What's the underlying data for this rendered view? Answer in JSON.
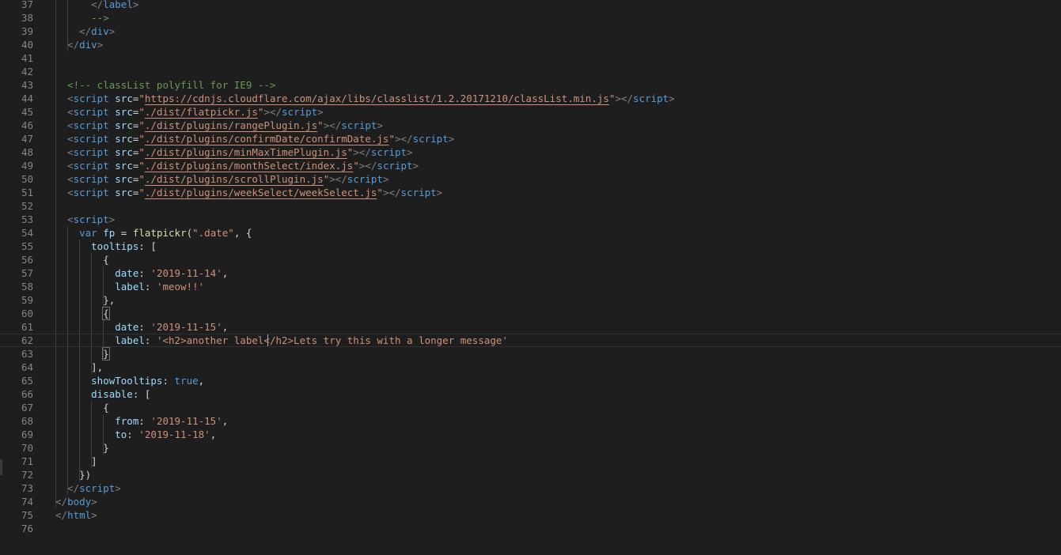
{
  "editor": {
    "current_line": 62,
    "lines": [
      {
        "n": "37",
        "tokens": [
          [
            "tk-punct",
            "      </"
          ],
          [
            "tk-tag",
            "label"
          ],
          [
            "tk-punct",
            ">"
          ]
        ]
      },
      {
        "n": "38",
        "tokens": [
          [
            "tk-comment",
            "      -->"
          ]
        ]
      },
      {
        "n": "39",
        "tokens": [
          [
            "tk-punct",
            "    </"
          ],
          [
            "tk-tag",
            "div"
          ],
          [
            "tk-punct",
            ">"
          ]
        ]
      },
      {
        "n": "40",
        "tokens": [
          [
            "tk-punct",
            "  </"
          ],
          [
            "tk-tag",
            "div"
          ],
          [
            "tk-punct",
            ">"
          ]
        ]
      },
      {
        "n": "41",
        "tokens": []
      },
      {
        "n": "42",
        "tokens": []
      },
      {
        "n": "43",
        "tokens": [
          [
            "tk-comment",
            "  <!-- classList polyfill for IE9 -->"
          ]
        ]
      },
      {
        "n": "44",
        "tokens": [
          [
            "tk-punct",
            "  <"
          ],
          [
            "tk-tag",
            "script"
          ],
          [
            "tk-plain",
            " "
          ],
          [
            "tk-attr",
            "src"
          ],
          [
            "tk-plain",
            "="
          ],
          [
            "tk-str",
            "\""
          ],
          [
            "tk-link",
            "https://cdnjs.cloudflare.com/ajax/libs/classlist/1.2.20171210/classList.min.js"
          ],
          [
            "tk-str",
            "\""
          ],
          [
            "tk-punct",
            "></"
          ],
          [
            "tk-tag",
            "script"
          ],
          [
            "tk-punct",
            ">"
          ]
        ]
      },
      {
        "n": "45",
        "tokens": [
          [
            "tk-punct",
            "  <"
          ],
          [
            "tk-tag",
            "script"
          ],
          [
            "tk-plain",
            " "
          ],
          [
            "tk-attr",
            "src"
          ],
          [
            "tk-plain",
            "="
          ],
          [
            "tk-str",
            "\""
          ],
          [
            "tk-link",
            "./dist/flatpickr.js"
          ],
          [
            "tk-str",
            "\""
          ],
          [
            "tk-punct",
            "></"
          ],
          [
            "tk-tag",
            "script"
          ],
          [
            "tk-punct",
            ">"
          ]
        ]
      },
      {
        "n": "46",
        "tokens": [
          [
            "tk-punct",
            "  <"
          ],
          [
            "tk-tag",
            "script"
          ],
          [
            "tk-plain",
            " "
          ],
          [
            "tk-attr",
            "src"
          ],
          [
            "tk-plain",
            "="
          ],
          [
            "tk-str",
            "\""
          ],
          [
            "tk-link",
            "./dist/plugins/rangePlugin.js"
          ],
          [
            "tk-str",
            "\""
          ],
          [
            "tk-punct",
            "></"
          ],
          [
            "tk-tag",
            "script"
          ],
          [
            "tk-punct",
            ">"
          ]
        ]
      },
      {
        "n": "47",
        "tokens": [
          [
            "tk-punct",
            "  <"
          ],
          [
            "tk-tag",
            "script"
          ],
          [
            "tk-plain",
            " "
          ],
          [
            "tk-attr",
            "src"
          ],
          [
            "tk-plain",
            "="
          ],
          [
            "tk-str",
            "\""
          ],
          [
            "tk-link",
            "./dist/plugins/confirmDate/confirmDate.js"
          ],
          [
            "tk-str",
            "\""
          ],
          [
            "tk-punct",
            "></"
          ],
          [
            "tk-tag",
            "script"
          ],
          [
            "tk-punct",
            ">"
          ]
        ]
      },
      {
        "n": "48",
        "tokens": [
          [
            "tk-punct",
            "  <"
          ],
          [
            "tk-tag",
            "script"
          ],
          [
            "tk-plain",
            " "
          ],
          [
            "tk-attr",
            "src"
          ],
          [
            "tk-plain",
            "="
          ],
          [
            "tk-str",
            "\""
          ],
          [
            "tk-link",
            "./dist/plugins/minMaxTimePlugin.js"
          ],
          [
            "tk-str",
            "\""
          ],
          [
            "tk-punct",
            "></"
          ],
          [
            "tk-tag",
            "script"
          ],
          [
            "tk-punct",
            ">"
          ]
        ]
      },
      {
        "n": "49",
        "tokens": [
          [
            "tk-punct",
            "  <"
          ],
          [
            "tk-tag",
            "script"
          ],
          [
            "tk-plain",
            " "
          ],
          [
            "tk-attr",
            "src"
          ],
          [
            "tk-plain",
            "="
          ],
          [
            "tk-str",
            "\""
          ],
          [
            "tk-link",
            "./dist/plugins/monthSelect/index.js"
          ],
          [
            "tk-str",
            "\""
          ],
          [
            "tk-punct",
            "></"
          ],
          [
            "tk-tag",
            "script"
          ],
          [
            "tk-punct",
            ">"
          ]
        ]
      },
      {
        "n": "50",
        "tokens": [
          [
            "tk-punct",
            "  <"
          ],
          [
            "tk-tag",
            "script"
          ],
          [
            "tk-plain",
            " "
          ],
          [
            "tk-attr",
            "src"
          ],
          [
            "tk-plain",
            "="
          ],
          [
            "tk-str",
            "\""
          ],
          [
            "tk-link",
            "./dist/plugins/scrollPlugin.js"
          ],
          [
            "tk-str",
            "\""
          ],
          [
            "tk-punct",
            "></"
          ],
          [
            "tk-tag",
            "script"
          ],
          [
            "tk-punct",
            ">"
          ]
        ]
      },
      {
        "n": "51",
        "tokens": [
          [
            "tk-punct",
            "  <"
          ],
          [
            "tk-tag",
            "script"
          ],
          [
            "tk-plain",
            " "
          ],
          [
            "tk-attr",
            "src"
          ],
          [
            "tk-plain",
            "="
          ],
          [
            "tk-str",
            "\""
          ],
          [
            "tk-link",
            "./dist/plugins/weekSelect/weekSelect.js"
          ],
          [
            "tk-str",
            "\""
          ],
          [
            "tk-punct",
            "></"
          ],
          [
            "tk-tag",
            "script"
          ],
          [
            "tk-punct",
            ">"
          ]
        ]
      },
      {
        "n": "52",
        "tokens": []
      },
      {
        "n": "53",
        "tokens": [
          [
            "tk-punct",
            "  <"
          ],
          [
            "tk-tag",
            "script"
          ],
          [
            "tk-punct",
            ">"
          ]
        ]
      },
      {
        "n": "54",
        "tokens": [
          [
            "tk-kw",
            "    var"
          ],
          [
            "tk-plain",
            " "
          ],
          [
            "tk-var",
            "fp"
          ],
          [
            "tk-plain",
            " = "
          ],
          [
            "tk-fn",
            "flatpickr"
          ],
          [
            "tk-plain",
            "("
          ],
          [
            "tk-str",
            "\".date\""
          ],
          [
            "tk-plain",
            ", {"
          ]
        ]
      },
      {
        "n": "55",
        "tokens": [
          [
            "tk-prop",
            "      tooltips"
          ],
          [
            "tk-plain",
            ": ["
          ]
        ]
      },
      {
        "n": "56",
        "tokens": [
          [
            "tk-plain",
            "        {"
          ]
        ]
      },
      {
        "n": "57",
        "tokens": [
          [
            "tk-prop",
            "          date"
          ],
          [
            "tk-plain",
            ": "
          ],
          [
            "tk-str",
            "'2019-11-14'"
          ],
          [
            "tk-plain",
            ","
          ]
        ]
      },
      {
        "n": "58",
        "tokens": [
          [
            "tk-prop",
            "          label"
          ],
          [
            "tk-plain",
            ": "
          ],
          [
            "tk-str",
            "'meow!!'"
          ]
        ]
      },
      {
        "n": "59",
        "tokens": [
          [
            "tk-plain",
            "        },"
          ]
        ]
      },
      {
        "n": "60",
        "tokens": [
          [
            "tk-plain",
            "        "
          ],
          [
            "tk-plain tk-bracket-hl",
            "{"
          ]
        ]
      },
      {
        "n": "61",
        "tokens": [
          [
            "tk-prop",
            "          date"
          ],
          [
            "tk-plain",
            ": "
          ],
          [
            "tk-str",
            "'2019-11-15'"
          ],
          [
            "tk-plain",
            ","
          ]
        ]
      },
      {
        "n": "62",
        "tokens": [
          [
            "tk-prop",
            "          label"
          ],
          [
            "tk-plain",
            ": "
          ],
          [
            "tk-str",
            "'<h2>another label</h2>Lets try this with a longer message'"
          ]
        ]
      },
      {
        "n": "63",
        "tokens": [
          [
            "tk-plain",
            "        "
          ],
          [
            "tk-plain tk-bracket-hl",
            "}"
          ]
        ]
      },
      {
        "n": "64",
        "tokens": [
          [
            "tk-plain",
            "      ],"
          ]
        ]
      },
      {
        "n": "65",
        "tokens": [
          [
            "tk-prop",
            "      showTooltips"
          ],
          [
            "tk-plain",
            ": "
          ],
          [
            "tk-bool",
            "true"
          ],
          [
            "tk-plain",
            ","
          ]
        ]
      },
      {
        "n": "66",
        "tokens": [
          [
            "tk-prop",
            "      disable"
          ],
          [
            "tk-plain",
            ": ["
          ]
        ]
      },
      {
        "n": "67",
        "tokens": [
          [
            "tk-plain",
            "        {"
          ]
        ]
      },
      {
        "n": "68",
        "tokens": [
          [
            "tk-prop",
            "          from"
          ],
          [
            "tk-plain",
            ": "
          ],
          [
            "tk-str",
            "'2019-11-15'"
          ],
          [
            "tk-plain",
            ","
          ]
        ]
      },
      {
        "n": "69",
        "tokens": [
          [
            "tk-prop",
            "          to"
          ],
          [
            "tk-plain",
            ": "
          ],
          [
            "tk-str",
            "'2019-11-18'"
          ],
          [
            "tk-plain",
            ","
          ]
        ]
      },
      {
        "n": "70",
        "tokens": [
          [
            "tk-plain",
            "        }"
          ]
        ]
      },
      {
        "n": "71",
        "tokens": [
          [
            "tk-plain",
            "      ]"
          ]
        ]
      },
      {
        "n": "72",
        "tokens": [
          [
            "tk-plain",
            "    })"
          ]
        ]
      },
      {
        "n": "73",
        "tokens": [
          [
            "tk-punct",
            "  </"
          ],
          [
            "tk-tag",
            "script"
          ],
          [
            "tk-punct",
            ">"
          ]
        ]
      },
      {
        "n": "74",
        "tokens": [
          [
            "tk-punct",
            "</"
          ],
          [
            "tk-tag",
            "body"
          ],
          [
            "tk-punct",
            ">"
          ]
        ]
      },
      {
        "n": "75",
        "tokens": [
          [
            "tk-punct",
            "</"
          ],
          [
            "tk-tag",
            "html"
          ],
          [
            "tk-punct",
            ">"
          ]
        ]
      },
      {
        "n": "76",
        "tokens": []
      }
    ]
  }
}
